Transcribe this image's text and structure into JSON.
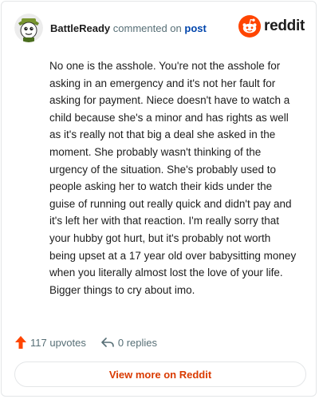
{
  "comment": {
    "author": "BattleReady",
    "action": "commented on",
    "target": "post",
    "body": "No one is the asshole. You're not the asshole for asking in an emergency and it's not her fault for asking for payment. Niece doesn't have to watch a child because she's a minor and has rights as well as it's really not that big a deal she asked in the moment. She probably wasn't thinking of the urgency of the situation. She's probably used to people asking her to watch their kids under the guise of running out really quick and didn't pay and it's left her with that reaction. I'm really sorry that your hubby got hurt, but it's probably not worth being upset at a 17 year old over babysitting money when you literally almost lost the love of your life. Bigger things to cry about imo."
  },
  "brand": {
    "name": "reddit",
    "icon": "reddit-snoo-icon",
    "color": "#ff4500"
  },
  "footer": {
    "upvotes": "117 upvotes",
    "upvote_icon": "upvote-arrow-icon",
    "upvote_color": "#ff4500",
    "replies": "0 replies",
    "reply_icon": "reply-arrow-icon"
  },
  "view_more": {
    "label": "View more on Reddit",
    "color": "#d93a00"
  }
}
